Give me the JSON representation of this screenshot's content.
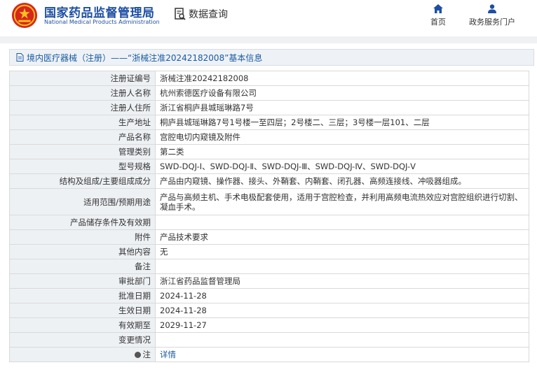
{
  "header": {
    "brand_cn": "国家药品监督管理局",
    "brand_en": "National Medical Products Administration",
    "query_label": "数据查询",
    "nav_home": "首页",
    "nav_portal": "政务服务门户"
  },
  "colors": {
    "brand": "#1e4fa3",
    "link": "#1a5aa0",
    "key_bg": "#eef1f4",
    "emblem_red": "#d7261e",
    "emblem_gold": "#f7c21a"
  },
  "icons": {
    "logo": "national-emblem-icon",
    "query": "search-document-icon",
    "home": "home-icon",
    "portal": "user-icon",
    "title": "document-icon",
    "note": "info-icon"
  },
  "title": "境内医疗器械（注册）——“浙械注准20242182008”基本信息",
  "fields": [
    {
      "label": "注册证编号",
      "value": "浙械注准20242182008"
    },
    {
      "label": "注册人名称",
      "value": "杭州索德医疗设备有限公司"
    },
    {
      "label": "注册人住所",
      "value": "浙江省桐庐县城瑶琳路7号"
    },
    {
      "label": "生产地址",
      "value": "桐庐县城瑶琳路7号1号楼一至四层；2号楼二、三层；3号楼一层101、二层"
    },
    {
      "label": "产品名称",
      "value": "宫腔电切内窥镜及附件"
    },
    {
      "label": "管理类别",
      "value": "第二类"
    },
    {
      "label": "型号规格",
      "value": "SWD-DQJ-Ⅰ、SWD-DQJ-Ⅱ、SWD-DQJ-Ⅲ、SWD-DQJ-Ⅳ、SWD-DQJ-Ⅴ"
    },
    {
      "label": "结构及组成/主要组成成分",
      "value": "产品由内窥镜、操作器、接头、外鞘套、内鞘套、闭孔器、高频连接线、冲吸器组成。"
    },
    {
      "label": "适用范围/预期用途",
      "value": "产品与高频主机、手术电极配套使用，适用于宫腔检查，并利用高频电流热效应对宫腔组织进行切割、凝血手术。"
    },
    {
      "label": "产品储存条件及有效期",
      "value": ""
    },
    {
      "label": "附件",
      "value": "产品技术要求"
    },
    {
      "label": "其他内容",
      "value": "无"
    },
    {
      "label": "备注",
      "value": ""
    },
    {
      "label": "审批部门",
      "value": "浙江省药品监督管理局"
    },
    {
      "label": "批准日期",
      "value": "2024-11-28"
    },
    {
      "label": "生效日期",
      "value": "2024-11-28"
    },
    {
      "label": "有效期至",
      "value": "2029-11-27"
    },
    {
      "label": "变更情况",
      "value": ""
    }
  ],
  "note": {
    "label": "注",
    "value": "详情"
  }
}
